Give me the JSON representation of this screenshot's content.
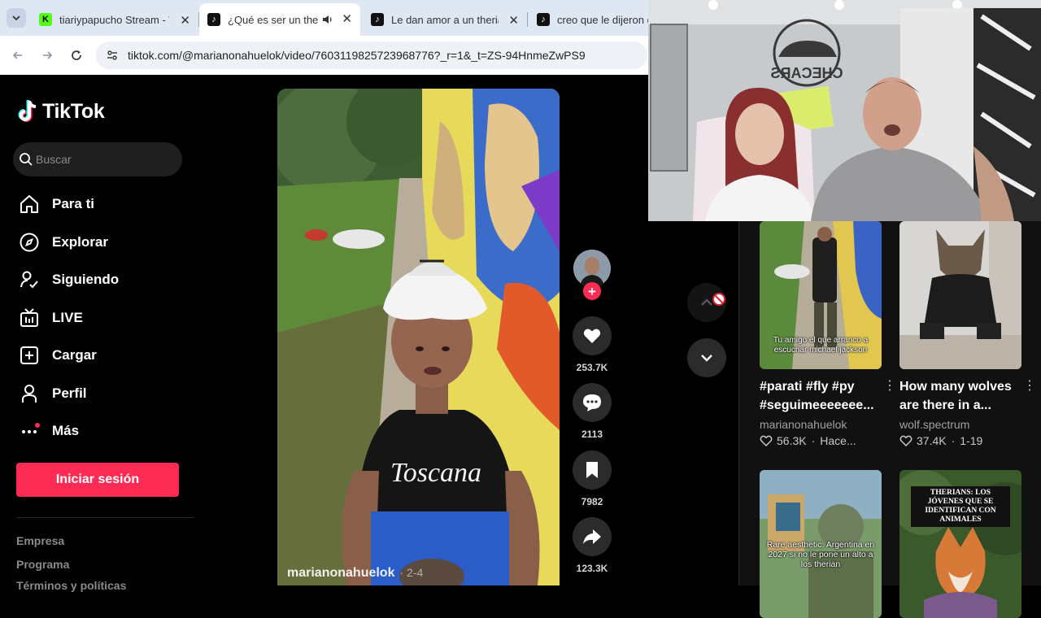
{
  "browser": {
    "tabs": [
      {
        "title": "tiariypapucho Stream - W",
        "favicon": "kick-icon",
        "active": false
      },
      {
        "title": "¿Qué es ser un therian",
        "favicon": "tiktok-icon",
        "active": true,
        "audio": "speaker-icon"
      },
      {
        "title": "Le dan amor a un therian",
        "favicon": "tiktok-icon",
        "active": false
      },
      {
        "title": "creo que le dijeron qu",
        "favicon": "tiktok-icon",
        "active": false
      }
    ],
    "url": "tiktok.com/@marianonahuelok/video/7603119825723968776?_r=1&_t=ZS-94HnmeZwPS9"
  },
  "sidebar": {
    "logo": "TikTok",
    "search_placeholder": "Buscar",
    "nav": [
      {
        "label": "Para ti",
        "icon": "home-icon"
      },
      {
        "label": "Explorar",
        "icon": "compass-icon"
      },
      {
        "label": "Siguiendo",
        "icon": "following-icon"
      },
      {
        "label": "LIVE",
        "icon": "live-tv-icon"
      },
      {
        "label": "Cargar",
        "icon": "upload-icon"
      },
      {
        "label": "Perfil",
        "icon": "profile-icon"
      },
      {
        "label": "Más",
        "icon": "more-dots-icon"
      }
    ],
    "login": "Iniciar sesión",
    "footer": [
      "Empresa",
      "Programa",
      "Términos y políticas"
    ]
  },
  "video": {
    "author": "marianonahuelok",
    "date": "· 2-4",
    "shirt_text": "Toscana"
  },
  "actions": {
    "likes": "253.7K",
    "comments": "2113",
    "saves": "7982",
    "shares": "123.3K"
  },
  "recommended": [
    {
      "title": "#parati #fly #py #seguimeeeeeee...",
      "author": "marianonahuelok",
      "likes": "56.3K",
      "date": "Hace...",
      "caption": "Tu amigo el que arranco a escuchar michael jackson"
    },
    {
      "title": "How many wolves are there in a...",
      "author": "wolf.spectrum",
      "likes": "37.4K",
      "date": "1-19",
      "caption": ""
    },
    {
      "caption": "Rare aesthetic: Argentina en 2027 si no le pone un alto a los therian"
    },
    {
      "caption": "THERIANS: LOS JÓVENES QUE SE IDENTIFICAN CON ANIMALES"
    }
  ],
  "webcam": {
    "sign": "CHECARS"
  },
  "colors": {
    "accent": "#fe2c55",
    "background": "#000000",
    "chrome": "#dfe7f3"
  }
}
